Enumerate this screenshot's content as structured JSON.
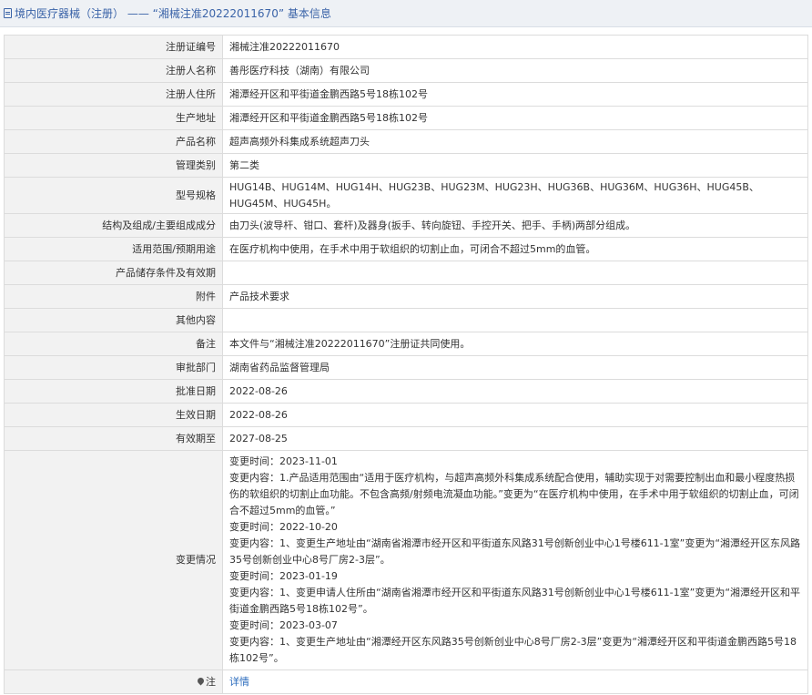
{
  "page_title": "境内医疗器械（注册） —— “湘械注准20222011670” 基本信息",
  "icons": {
    "title": "document-icon",
    "note": "pin-icon"
  },
  "colors": {
    "title_text": "#3a63a8",
    "link": "#2a6bbd",
    "label_bg": "#f2f2f2",
    "border": "#dcdcdc"
  },
  "rows": [
    {
      "label": "注册证编号",
      "value": "湘械注准20222011670"
    },
    {
      "label": "注册人名称",
      "value": "善彤医疗科技（湖南）有限公司"
    },
    {
      "label": "注册人住所",
      "value": "湘潭经开区和平街道金鹏西路5号18栋102号"
    },
    {
      "label": "生产地址",
      "value": "湘潭经开区和平街道金鹏西路5号18栋102号"
    },
    {
      "label": "产品名称",
      "value": "超声高频外科集成系统超声刀头"
    },
    {
      "label": "管理类别",
      "value": "第二类"
    },
    {
      "label": "型号规格",
      "value": "HUG14B、HUG14M、HUG14H、HUG23B、HUG23M、HUG23H、HUG36B、HUG36M、HUG36H、HUG45B、HUG45M、HUG45H。"
    },
    {
      "label": "结构及组成/主要组成成分",
      "value": "由刀头(波导杆、钳口、套杆)及器身(扳手、转向旋钮、手控开关、把手、手柄)两部分组成。"
    },
    {
      "label": "适用范围/预期用途",
      "value": "在医疗机构中使用，在手术中用于软组织的切割止血，可闭合不超过5mm的血管。"
    },
    {
      "label": "产品储存条件及有效期",
      "value": ""
    },
    {
      "label": "附件",
      "value": "产品技术要求"
    },
    {
      "label": "其他内容",
      "value": ""
    },
    {
      "label": "备注",
      "value": "本文件与“湘械注准20222011670”注册证共同使用。"
    },
    {
      "label": "审批部门",
      "value": "湖南省药品监督管理局"
    },
    {
      "label": "批准日期",
      "value": "2022-08-26"
    },
    {
      "label": "生效日期",
      "value": "2022-08-26"
    },
    {
      "label": "有效期至",
      "value": "2027-08-25"
    }
  ],
  "changes": {
    "label": "变更情况",
    "entries": [
      {
        "time": "变更时间：2023-11-01",
        "content": "变更内容：1.产品适用范围由“适用于医疗机构，与超声高频外科集成系统配合使用，辅助实现于对需要控制出血和最小程度热损伤的软组织的切割止血功能。不包含高频/射频电流凝血功能。”变更为“在医疗机构中使用，在手术中用于软组织的切割止血，可闭合不超过5mm的血管。”"
      },
      {
        "time": "变更时间：2022-10-20",
        "content": "变更内容：1、变更生产地址由“湖南省湘潭市经开区和平街道东风路31号创新创业中心1号楼611-1室”变更为“湘潭经开区东风路35号创新创业中心8号厂房2-3层”。"
      },
      {
        "time": "变更时间：2023-01-19",
        "content": "变更内容：1、变更申请人住所由“湖南省湘潭市经开区和平街道东风路31号创新创业中心1号楼611-1室”变更为“湘潭经开区和平街道金鹏西路5号18栋102号”。"
      },
      {
        "time": "变更时间：2023-03-07",
        "content": "变更内容：1、变更生产地址由“湘潭经开区东风路35号创新创业中心8号厂房2-3层”变更为“湘潭经开区和平街道金鹏西路5号18栋102号”。"
      }
    ]
  },
  "note": {
    "label": "注",
    "link_text": "详情"
  }
}
